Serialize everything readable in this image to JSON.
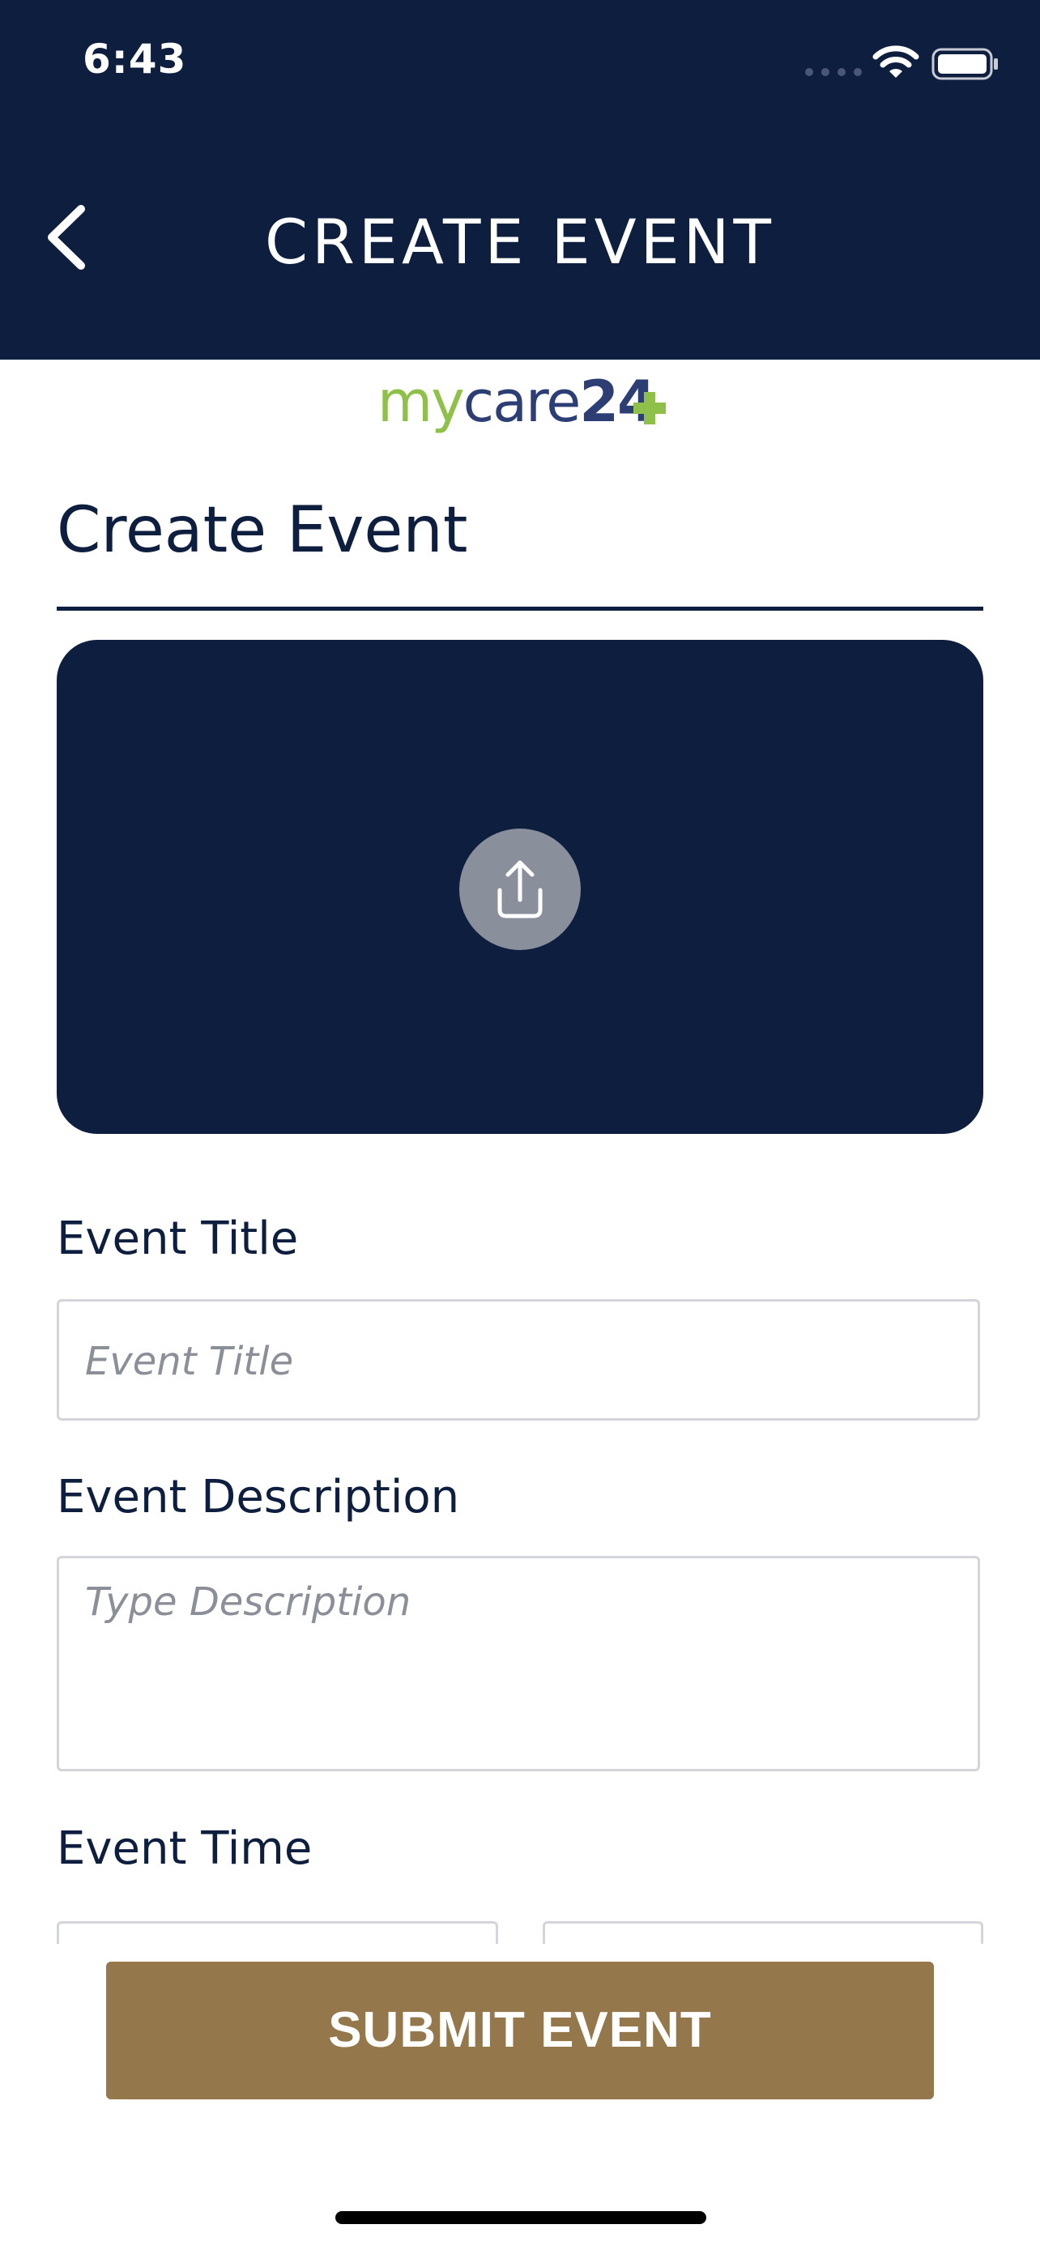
{
  "status_bar": {
    "time": "6:43"
  },
  "header": {
    "title": "CREATE EVENT",
    "back_icon": "chevron-left-icon",
    "background_color": "#0e1e3e"
  },
  "logo": {
    "part_my": "my",
    "part_care": "care",
    "part_number": "24",
    "accent_color": "#8fc04a",
    "brand_color": "#2d3e74"
  },
  "form": {
    "section_title": "Create Event",
    "upload": {
      "icon": "upload-icon"
    },
    "event_title": {
      "label": "Event Title",
      "placeholder": "Event Title",
      "value": ""
    },
    "event_description": {
      "label": "Event Description",
      "placeholder": "Type Description",
      "value": ""
    },
    "event_time": {
      "label": "Event Time"
    }
  },
  "submit": {
    "label": "SUBMIT EVENT",
    "color": "#94784b"
  }
}
